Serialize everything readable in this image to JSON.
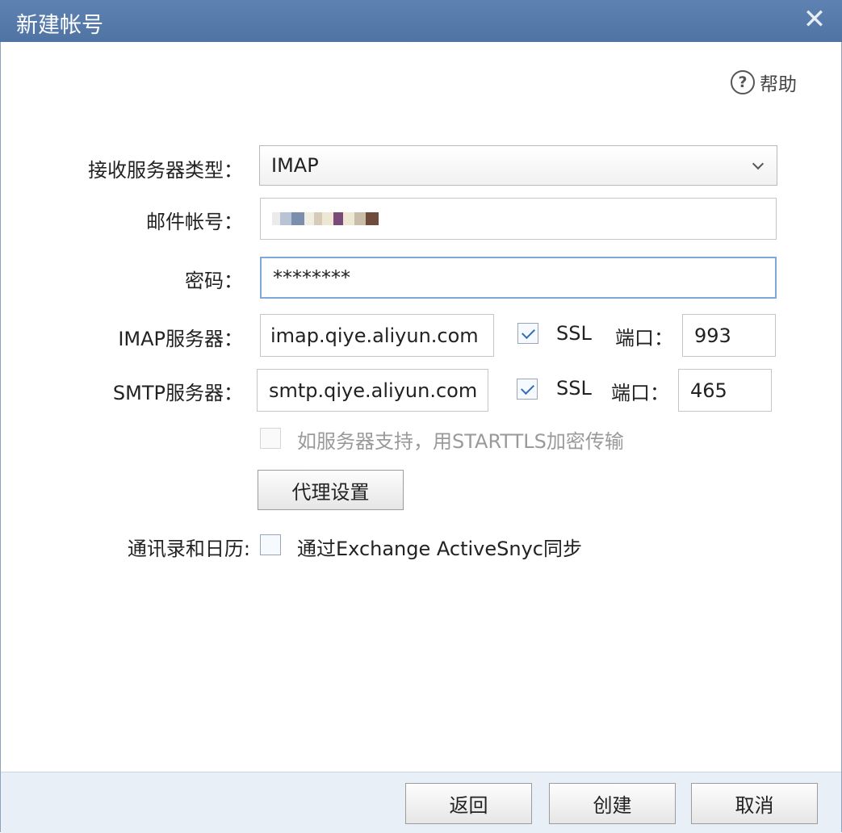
{
  "window": {
    "title": "新建帐号",
    "close_icon": "close-icon"
  },
  "help": {
    "label": "帮助",
    "icon": "question-circle-icon"
  },
  "form": {
    "server_type": {
      "label": "接收服务器类型：",
      "value": "IMAP"
    },
    "account": {
      "label": "邮件帐号："
    },
    "password": {
      "label": "密码：",
      "value": "********"
    },
    "imap": {
      "label": "IMAP服务器：",
      "value": "imap.qiye.aliyun.com",
      "ssl_label": "SSL",
      "ssl_checked": true,
      "port_label": "端口：",
      "port": "993"
    },
    "smtp": {
      "label": "SMTP服务器：",
      "value": "smtp.qiye.aliyun.com",
      "ssl_label": "SSL",
      "ssl_checked": true,
      "port_label": "端口：",
      "port": "465"
    },
    "starttls": {
      "label": "如服务器支持，用STARTTLS加密传输",
      "checked": false,
      "disabled": true
    },
    "proxy_button": "代理设置",
    "sync": {
      "label": "通讯录和日历:",
      "option": "通过Exchange ActiveSnyc同步",
      "checked": false
    }
  },
  "footer": {
    "back": "返回",
    "create": "创建",
    "cancel": "取消"
  },
  "colors": {
    "titlebar": "#5479a9",
    "footer": "#e9eff6",
    "focus_border": "#7fa9d9"
  }
}
